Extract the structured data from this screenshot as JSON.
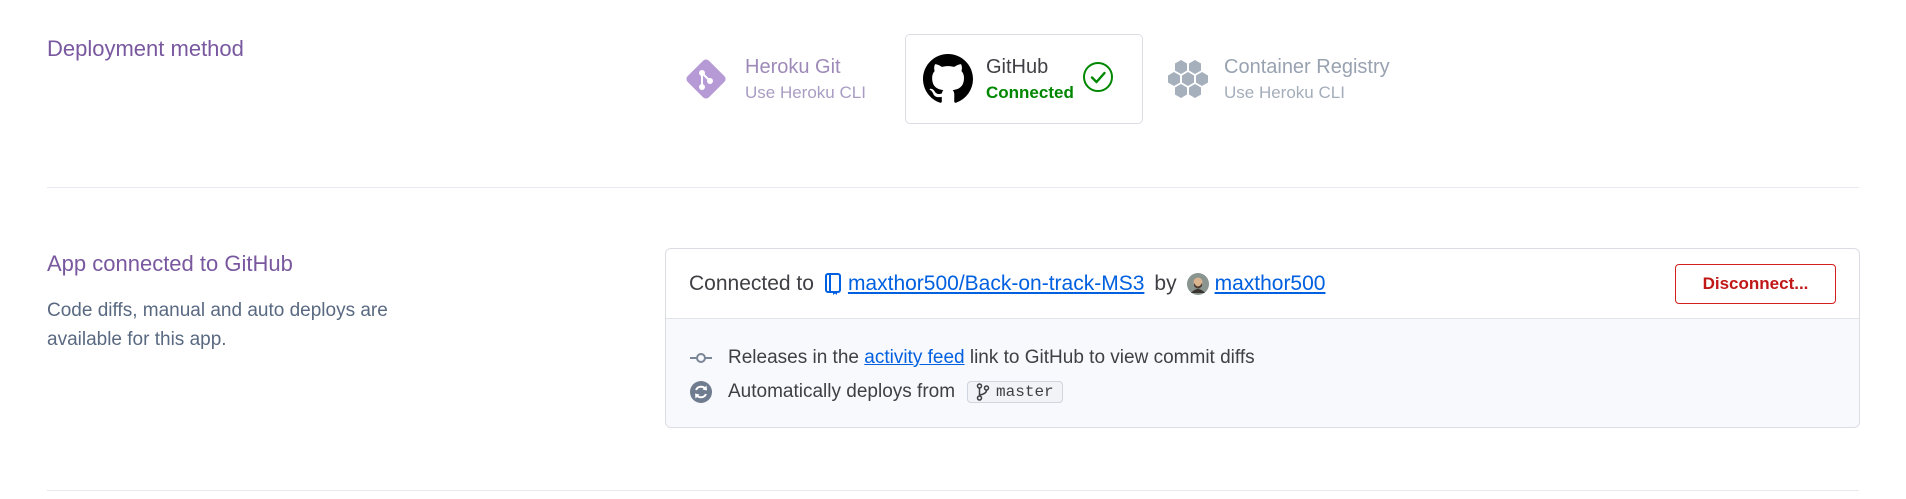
{
  "deployment": {
    "title": "Deployment method",
    "methods": [
      {
        "name": "Heroku Git",
        "sub": "Use Heroku CLI",
        "icon": "heroku-git-icon"
      },
      {
        "name": "GitHub",
        "sub": "Connected",
        "icon": "github-icon",
        "selected": true
      },
      {
        "name": "Container Registry",
        "sub": "Use Heroku CLI",
        "icon": "container-registry-icon"
      }
    ]
  },
  "connection": {
    "title": "App connected to GitHub",
    "description": "Code diffs, manual and auto deploys are available for this app.",
    "connected_to_label": "Connected to",
    "repo": "maxthor500/Back-on-track-MS3",
    "by_label": "by",
    "user": "maxthor500",
    "disconnect_label": "Disconnect...",
    "releases_prefix": "Releases in the",
    "activity_feed_link": "activity feed",
    "releases_suffix": "link to GitHub to view commit diffs",
    "auto_deploy_label": "Automatically deploys from",
    "branch": "master"
  },
  "colors": {
    "accent": "#79589f",
    "connected": "#008700",
    "danger": "#d21f1f",
    "link": "#0060e0"
  }
}
